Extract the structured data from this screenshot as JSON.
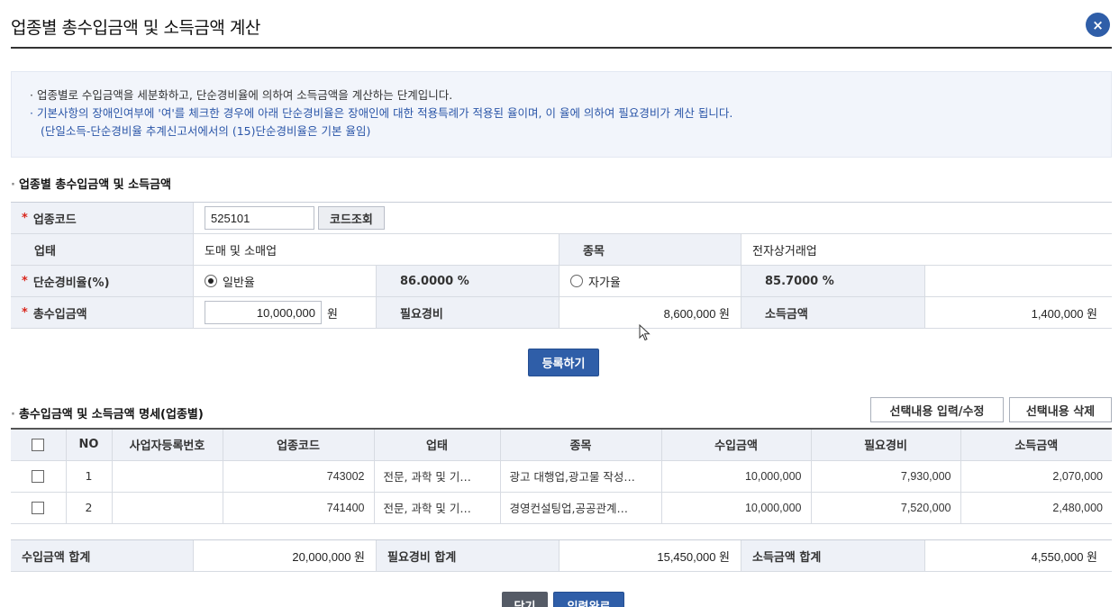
{
  "dialog": {
    "title": "업종별 총수입금액 및 소득금액 계산",
    "close_icon": "×"
  },
  "notice": {
    "line1": "· 업종별로 수입금액을 세분화하고, 단순경비율에 의하여 소득금액을 계산하는 단계입니다.",
    "line2": "· 기본사항의 장애인여부에 '여'를 체크한 경우에 아래 단순경비율은 장애인에 대한 적용특례가 적용된 율이며, 이 율에 의하여 필요경비가 계산 됩니다.",
    "line3": "(단일소득-단순경비율 추계신고서에서의 (15)단순경비율은 기본 율임)"
  },
  "form": {
    "section_title": "업종별 총수입금액 및 소득금액",
    "required_mark": "*",
    "industry_code_label": "업종코드",
    "industry_code_value": "525101",
    "code_lookup_button": "코드조회",
    "business_type_label": "업태",
    "business_type_value": "도매 및 소매업",
    "item_label": "종목",
    "item_value": "전자상거래업",
    "rate_label": "단순경비율(%)",
    "rate_general_label": "일반율",
    "rate_general_value": "86.0000 %",
    "rate_self_label": "자가율",
    "rate_self_value": "85.7000 %",
    "total_income_label": "총수입금액",
    "total_income_value": "10,000,000",
    "won": "원",
    "expense_label": "필요경비",
    "expense_value": "8,600,000 원",
    "income_label": "소득금액",
    "income_value": "1,400,000 원",
    "register_button": "등록하기"
  },
  "list": {
    "section_title": "총수입금액 및 소득금액 명세(업종별)",
    "edit_button": "선택내용 입력/수정",
    "delete_button": "선택내용 삭제",
    "columns": [
      "NO",
      "사업자등록번호",
      "업종코드",
      "업태",
      "종목",
      "수입금액",
      "필요경비",
      "소득금액"
    ],
    "rows": [
      {
        "no": "1",
        "biz_no": "",
        "code": "743002",
        "type": "전문, 과학 및 기…",
        "item": "광고 대행업,광고물 작성…",
        "income": "10,000,000",
        "expense": "7,930,000",
        "profit": "2,070,000"
      },
      {
        "no": "2",
        "biz_no": "",
        "code": "741400",
        "type": "전문, 과학 및 기…",
        "item": "경영컨설팅업,공공관계…",
        "income": "10,000,000",
        "expense": "7,520,000",
        "profit": "2,480,000"
      }
    ]
  },
  "summary": {
    "income_sum_label": "수입금액 합계",
    "income_sum_value": "20,000,000 원",
    "expense_sum_label": "필요경비 합계",
    "expense_sum_value": "15,450,000 원",
    "profit_sum_label": "소득금액 합계",
    "profit_sum_value": "4,550,000 원"
  },
  "footer": {
    "close_button": "닫기",
    "complete_button": "입력완료"
  }
}
